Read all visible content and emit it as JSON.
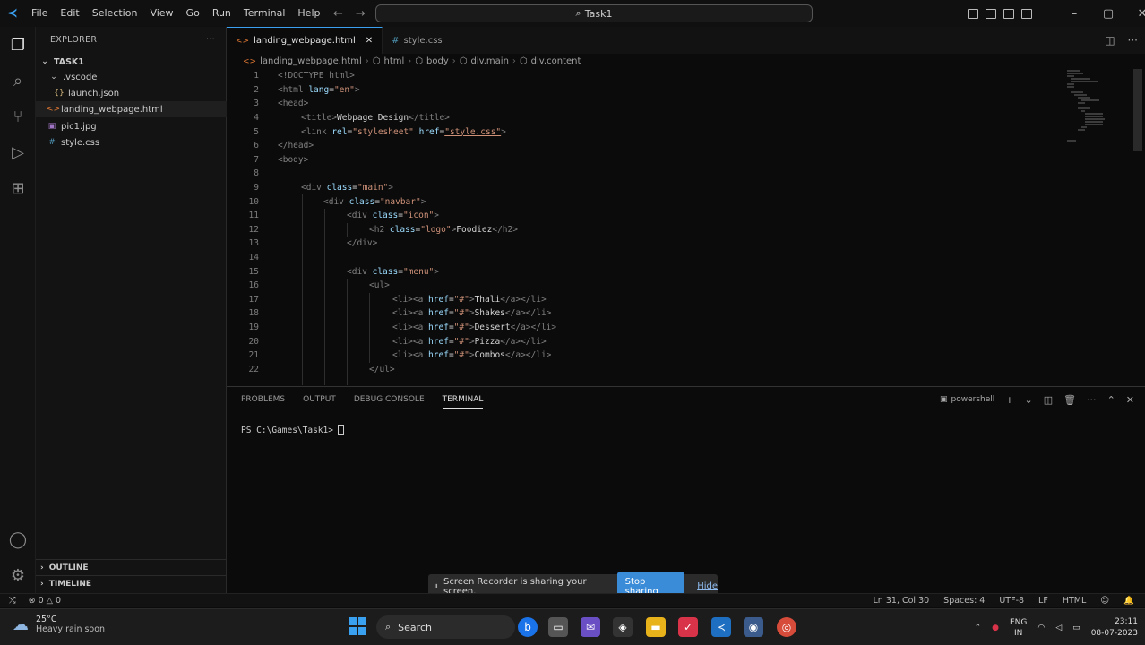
{
  "menu": [
    "File",
    "Edit",
    "Selection",
    "View",
    "Go",
    "Run",
    "Terminal",
    "Help"
  ],
  "command_center": "Task1",
  "sidebar": {
    "title": "EXPLORER",
    "more": "···",
    "folder": "TASK1",
    "items": [
      {
        "label": ".vscode",
        "icon": "chevron-down-icon"
      },
      {
        "label": "launch.json",
        "icon": "json-icon"
      },
      {
        "label": "landing_webpage.html",
        "icon": "html-icon"
      },
      {
        "label": "pic1.jpg",
        "icon": "image-icon"
      },
      {
        "label": "style.css",
        "icon": "css-icon"
      }
    ],
    "outline": "OUTLINE",
    "timeline": "TIMELINE"
  },
  "tabs": [
    {
      "label": "landing_webpage.html",
      "close": "✕"
    },
    {
      "label": "style.css"
    }
  ],
  "breadcrumb": [
    "landing_webpage.html",
    "html",
    "body",
    "div.main",
    "div.content"
  ],
  "code": {
    "line_numbers": [
      "1",
      "2",
      "3",
      "4",
      "5",
      "6",
      "7",
      "8",
      "9",
      "10",
      "11",
      "12",
      "13",
      "14",
      "15",
      "16",
      "17",
      "18",
      "19",
      "20",
      "21",
      "22"
    ],
    "l1_a": "<!DOCTYPE html>",
    "l2_a": "<html ",
    "l2_b": "lang",
    "l2_c": "=",
    "l2_d": "\"en\"",
    "l2_e": ">",
    "l3_a": "<head>",
    "l4_a": "<title>",
    "l4_b": "Webpage Design",
    "l4_c": "</title>",
    "l5_a": "<link ",
    "l5_b": "rel",
    "l5_c": "=",
    "l5_d": "\"stylesheet\"",
    "l5_e": " href",
    "l5_f": "=",
    "l5_g": "\"style.css\"",
    "l5_h": ">",
    "l6_a": "</head>",
    "l7_a": "<body>",
    "l9_a": "<div ",
    "l9_b": "class",
    "l9_c": "=",
    "l9_d": "\"main\"",
    "l9_e": ">",
    "l10_a": "<div ",
    "l10_b": "class",
    "l10_c": "=",
    "l10_d": "\"navbar\"",
    "l10_e": ">",
    "l11_a": "<div ",
    "l11_b": "class",
    "l11_c": "=",
    "l11_d": "\"icon\"",
    "l11_e": ">",
    "l12_a": "<h2 ",
    "l12_b": "class",
    "l12_c": "=",
    "l12_d": "\"logo\"",
    "l12_e": ">",
    "l12_f": "Foodiez",
    "l12_g": "</h2>",
    "l13_a": "</div>",
    "l15_a": "<div ",
    "l15_b": "class",
    "l15_c": "=",
    "l15_d": "\"menu\"",
    "l15_e": ">",
    "l16_a": "<ul>",
    "li_open": "<li><a ",
    "li_href": "href",
    "li_eq": "=",
    "li_val": "\"#\"",
    "li_gt": ">",
    "li_close": "</a></li>",
    "l17_t": "Thali",
    "l18_t": "Shakes",
    "l19_t": "Dessert",
    "l20_t": "Pizza",
    "l21_t": "Combos",
    "l22_a": "</ul>"
  },
  "panel": {
    "tabs": [
      "PROBLEMS",
      "OUTPUT",
      "DEBUG CONSOLE",
      "TERMINAL"
    ],
    "shell": "powershell",
    "prompt": "PS C:\\Games\\Task1>"
  },
  "recorder": {
    "message": "Screen Recorder is sharing your screen.",
    "stop": "Stop sharing",
    "hide": "Hide"
  },
  "status": {
    "errors": "0",
    "warnings": "0",
    "position": "Ln 31, Col 30",
    "spaces": "Spaces: 4",
    "encoding": "UTF-8",
    "eol": "LF",
    "language": "HTML"
  },
  "taskbar": {
    "temp": "25°C",
    "weather": "Heavy rain soon",
    "search": "Search",
    "lang1": "ENG",
    "lang2": "IN",
    "time": "23:11",
    "date": "08-07-2023"
  },
  "colors": {
    "accent": "#3aa0f0",
    "stop_button": "#3a8bd8"
  }
}
